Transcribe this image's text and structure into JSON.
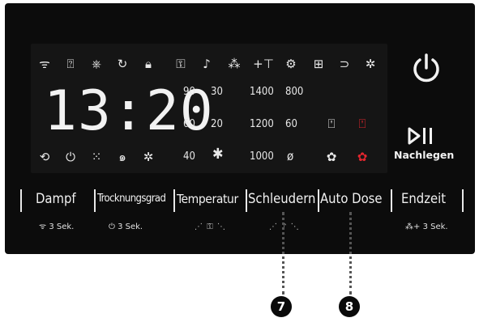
{
  "display": {
    "time": "13:20",
    "top_icons": [
      "wifi-icon",
      "door-lock-icon",
      "stain-icon",
      "rinse-icon",
      "child-lock-icon",
      "key-icon",
      "mute-icon",
      "extra-icon",
      "add-garment-icon",
      "sensor-icon",
      "grid-icon",
      "drawer-icon",
      "settings-icon"
    ],
    "temperatures": [
      "90",
      "30",
      "60",
      "20",
      "40"
    ],
    "spin_speeds": [
      "1400",
      "800",
      "1200",
      "60",
      "1000"
    ],
    "cold_symbol": "✱",
    "no_spin_symbol": "ø",
    "bottom_icons": [
      "timer-icon",
      "eco-icon",
      "dots-icon",
      "swirl-icon",
      "cog-icon"
    ]
  },
  "power": {
    "label": "power-icon"
  },
  "start_pause": {
    "label": "Nachlegen"
  },
  "buttons": [
    {
      "id": "dampf",
      "label": "Dampf"
    },
    {
      "id": "trocknungsgrad",
      "label": "Trocknungsgrad"
    },
    {
      "id": "temperatur",
      "label": "Temperatur"
    },
    {
      "id": "schleudern",
      "label": "Schleudern"
    },
    {
      "id": "auto-dose",
      "label": "Auto Dose"
    },
    {
      "id": "endzeit",
      "label": "Endzeit"
    }
  ],
  "hints": {
    "dampf": "3 Sek.",
    "trocknungsgrad": "3 Sek.",
    "endzeit": "3 Sek."
  },
  "markers": [
    "7",
    "8"
  ],
  "colors": {
    "panel": "#0c0c0c",
    "accent_red": "#e2262e",
    "text": "#f0f0f0"
  }
}
